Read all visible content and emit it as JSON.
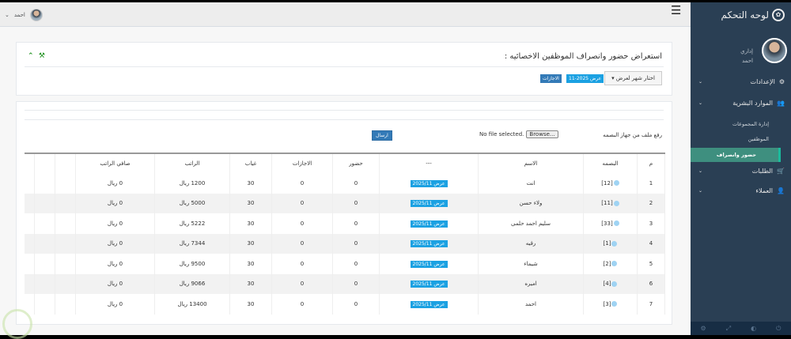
{
  "topbar": {
    "user_name": "احمد"
  },
  "sidebar": {
    "brand": "لوحه التحكم",
    "welcome": "إداري",
    "user": "احمد",
    "items": [
      {
        "label": "الإعدادات",
        "icon": "gears-icon"
      },
      {
        "label": "الموارد البشرية",
        "icon": "users-icon"
      },
      {
        "label": "الطلبات",
        "icon": "cart-icon"
      },
      {
        "label": "العملاء",
        "icon": "user-icon"
      }
    ],
    "sub_items": [
      {
        "label": "إدارة المجموعات"
      },
      {
        "label": "الموظفين"
      },
      {
        "label": "حضور وانصراف"
      }
    ]
  },
  "panel1": {
    "title": "استعراض حضور وانصراف الموظفين الاخصائيه :",
    "month_select": "اختار شهر لعرض",
    "view_badge": "عرض 2025-11",
    "vacations_badge": "الاجازات"
  },
  "upload": {
    "label": "رفع ملف من جهاز البصمه",
    "browse": "Browse...",
    "no_file": "No file selected.",
    "send": "ارسال"
  },
  "table": {
    "headers": [
      "م",
      "البصمه",
      "الاسم",
      "---",
      "حضور",
      "الاجازات",
      "غياب",
      "الراتب",
      "صافي الراتب"
    ],
    "rows": [
      {
        "n": "1",
        "fp": "[12]",
        "name": "انت",
        "view": "عرض 2025/11",
        "present": "0",
        "vac": "0",
        "absent": "30",
        "salary": "1200 ريال",
        "net": "0 ريال"
      },
      {
        "n": "2",
        "fp": "[11]",
        "name": "ولاء حسن",
        "view": "عرض 2025/11",
        "present": "0",
        "vac": "0",
        "absent": "30",
        "salary": "5000 ريال",
        "net": "0 ريال"
      },
      {
        "n": "3",
        "fp": "[33]",
        "name": "سليم احمد حلمى",
        "view": "عرض 2025/11",
        "present": "0",
        "vac": "0",
        "absent": "30",
        "salary": "5222 ريال",
        "net": "0 ريال"
      },
      {
        "n": "4",
        "fp": "[1]",
        "name": "رقيه",
        "view": "عرض 2025/11",
        "present": "0",
        "vac": "0",
        "absent": "30",
        "salary": "7344 ريال",
        "net": "0 ريال"
      },
      {
        "n": "5",
        "fp": "[2]",
        "name": "شيماء",
        "view": "عرض 2025/11",
        "present": "0",
        "vac": "0",
        "absent": "30",
        "salary": "9500 ريال",
        "net": "0 ريال"
      },
      {
        "n": "6",
        "fp": "[4]",
        "name": "اميره",
        "view": "عرض 2025/11",
        "present": "0",
        "vac": "0",
        "absent": "30",
        "salary": "9066 ريال",
        "net": "0 ريال"
      },
      {
        "n": "7",
        "fp": "[3]",
        "name": "احمد",
        "view": "عرض 2025/11",
        "present": "0",
        "vac": "0",
        "absent": "30",
        "salary": "13400 ريال",
        "net": "0 ريال"
      }
    ]
  }
}
